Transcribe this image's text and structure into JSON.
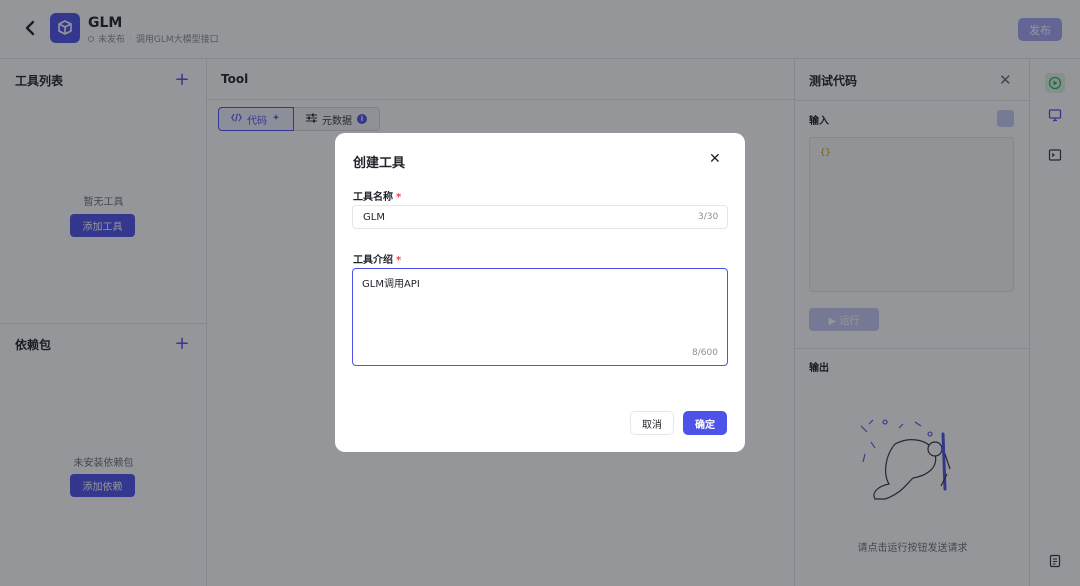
{
  "header": {
    "app_name": "GLM",
    "status": "未发布",
    "separator": "·",
    "description": "调用GLM大模型接口",
    "publish_label": "发布"
  },
  "tools_panel": {
    "title": "工具列表",
    "add_icon": "+",
    "empty_text": "暂无工具",
    "add_button": "添加工具"
  },
  "deps_panel": {
    "title": "依赖包",
    "add_icon": "+",
    "empty_text": "未安装依赖包",
    "add_button": "添加依赖"
  },
  "editor": {
    "title": "Tool",
    "tabs": [
      {
        "label": "代码",
        "icon": "code-icon",
        "active": true
      },
      {
        "label": "元数据",
        "icon": "sliders-icon",
        "active": false
      }
    ]
  },
  "test_panel": {
    "title": "测试代码",
    "input_label": "输入",
    "input_value": "{}",
    "run_label": "运行",
    "output_label": "输出",
    "hint": "请点击运行按钮发送请求"
  },
  "modal": {
    "title": "创建工具",
    "name_label": "工具名称",
    "required_mark": "*",
    "name_value": "GLM",
    "name_count": "3/30",
    "desc_label": "工具介绍",
    "desc_value": "GLM调用API",
    "desc_count": "8/600",
    "cancel_label": "取消",
    "confirm_label": "确定"
  },
  "colors": {
    "accent": "#4d53e8",
    "accent_disabled": "#a5a8f4",
    "required": "#e5484d"
  }
}
